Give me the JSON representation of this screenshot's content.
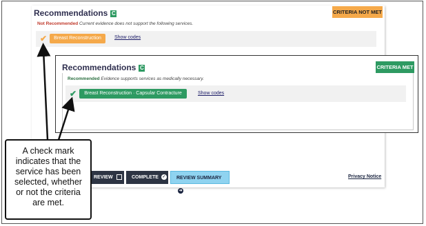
{
  "panel": {
    "title": "Recommendations",
    "badge": "C",
    "status": "CRITERIA NOT MET",
    "note_label": "Not Recommended",
    "note_text": "Current evidence does not support the following services.",
    "service": "Breast Reconstruction",
    "show_codes": "Show codes"
  },
  "inner": {
    "title": "Recommendations",
    "badge": "C",
    "status": "CRITERIA MET",
    "note_label": "Recommended",
    "note_text": "Evidence supports services as medically necessary.",
    "service": "Breast Reconstruction · Capsular Contracture",
    "show_codes": "Show codes"
  },
  "footer": {
    "review": "REVIEW",
    "complete": "COMPLETE",
    "review_summary": "REVIEW SUMMARY",
    "privacy": "Privacy Notice"
  },
  "callout": {
    "text": "A check mark\nindicates that the\nservice has been\nselected, whether\nor not the criteria\nare met."
  },
  "colors": {
    "green": "#2e9a62",
    "orange": "#f5a94a",
    "dark": "#2d3443",
    "blue": "#8fd3f0"
  }
}
